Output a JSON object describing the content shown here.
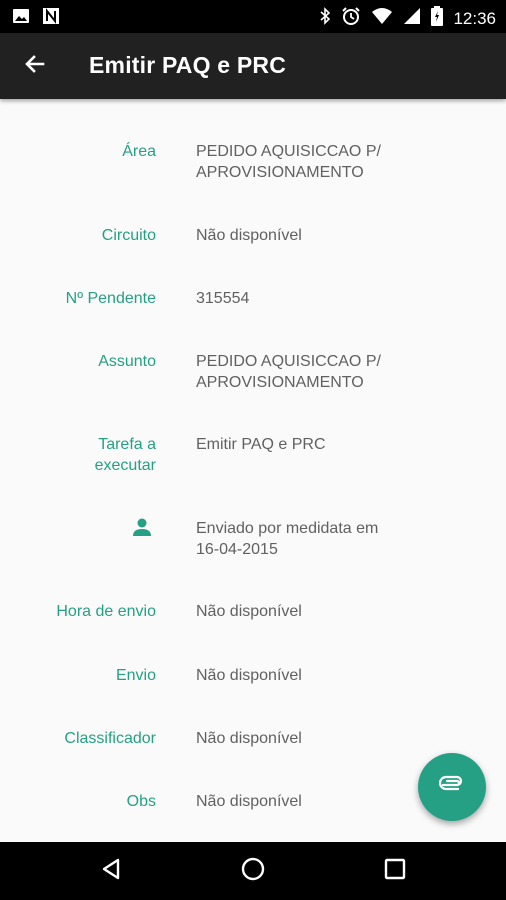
{
  "status_bar": {
    "time": "12:36",
    "left_icons": [
      "image-icon",
      "n-notification-icon"
    ],
    "right_icons": [
      "bluetooth-icon",
      "alarm-icon",
      "wifi-icon",
      "cell-signal-icon",
      "battery-icon"
    ]
  },
  "app_bar": {
    "title": "Emitir PAQ e PRC",
    "back_icon": "arrow-back-icon"
  },
  "fields": [
    {
      "label": "Área",
      "value": "PEDIDO AQUISICCAO P/\nAPROVISIONAMENTO"
    },
    {
      "label": "Circuito",
      "value": "Não disponível"
    },
    {
      "label": "Nº Pendente",
      "value": "315554"
    },
    {
      "label": "Assunto",
      "value": "PEDIDO AQUISICCAO P/\nAPROVISIONAMENTO"
    },
    {
      "label": "Tarefa a\nexecutar",
      "value": "Emitir PAQ e PRC"
    },
    {
      "label_icon": "person-icon",
      "value": "Enviado por medidata em\n16-04-2015"
    },
    {
      "label": "Hora de envio",
      "value": "Não disponível"
    },
    {
      "label": "Envio",
      "value": "Não disponível"
    },
    {
      "label": "Classificador",
      "value": "Não disponível"
    },
    {
      "label": "Obs",
      "value": "Não disponível"
    }
  ],
  "fab": {
    "icon": "attachment-icon"
  },
  "nav_bar": {
    "icons": [
      "back-triangle-icon",
      "home-circle-icon",
      "recents-square-icon"
    ]
  },
  "colors": {
    "accent": "#26a085",
    "app_bar": "#212121",
    "status_bar": "#000000",
    "background": "#fafafa",
    "value_text": "#616161"
  }
}
